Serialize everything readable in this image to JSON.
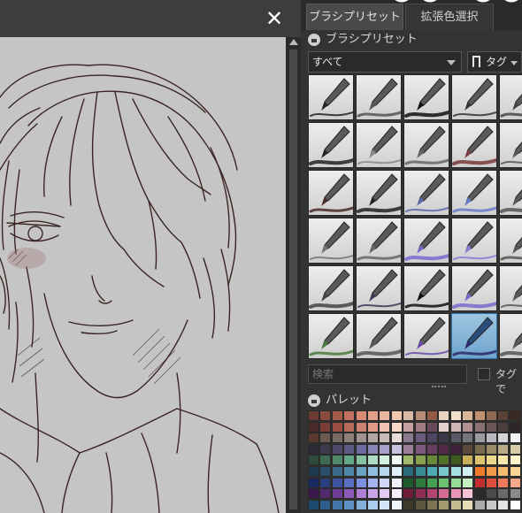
{
  "canvas": {
    "close_label": "✕"
  },
  "right_panel": {
    "tabs": [
      {
        "label": "ブラシプリセット"
      },
      {
        "label": "拡張色選択"
      }
    ],
    "brush_section": {
      "title": "ブラシプリセット"
    },
    "filter": {
      "selected": "すべて"
    },
    "tag_button": {
      "label": "タグ"
    },
    "search": {
      "placeholder": "検索",
      "checkbox_label": "タグで"
    },
    "palette_section": {
      "title": "パレット"
    },
    "brushes": [
      {
        "name": "mechanical-pen-brush"
      },
      {
        "name": "rough-pen-brush"
      },
      {
        "name": "g-pen-brush"
      },
      {
        "name": "airbrush-brush"
      },
      {
        "name": "cut-off-brush"
      },
      {
        "name": "marker-pen-brush"
      },
      {
        "name": "pencil-light-brush"
      },
      {
        "name": "pencil-brush"
      },
      {
        "name": "brush-pen-brush"
      },
      {
        "name": "cut-off-brush-2"
      },
      {
        "name": "watercolor-brush"
      },
      {
        "name": "ink-pen-brush"
      },
      {
        "name": "blue-pencil-brush"
      },
      {
        "name": "blue-pencil-brush-2"
      },
      {
        "name": "cut-off-brush-3"
      },
      {
        "name": "soft-pencil-brush"
      },
      {
        "name": "soft-pencil-brush-2"
      },
      {
        "name": "purple-pencil-brush"
      },
      {
        "name": "purple-pencil-brush-2"
      },
      {
        "name": "cut-off-brush-4"
      },
      {
        "name": "gray-marker-brush"
      },
      {
        "name": "blue-marker-brush"
      },
      {
        "name": "texture-marker-brush"
      },
      {
        "name": "text-pencil-brush"
      },
      {
        "name": "cut-off-brush-5"
      },
      {
        "name": "green-paint-brush"
      },
      {
        "name": "text-gray-brush"
      },
      {
        "name": "text-purple-brush"
      },
      {
        "name": "selected-pen-brush"
      },
      {
        "name": "cut-off-brush-6"
      }
    ],
    "palette_colors": [
      "#6b3a32",
      "#8a4a3e",
      "#a65a48",
      "#c47060",
      "#d98a72",
      "#e3a088",
      "#eab59e",
      "#f0c8b0",
      "#d8b8a6",
      "#b88a78",
      "#945a48",
      "#e8d4c0",
      "#f0e0cc",
      "#d9b89a",
      "#c09070",
      "#8e6a52",
      "#5a4236",
      "#3a2a22",
      "#4a2a2a",
      "#7a3e36",
      "#9a4e42",
      "#b86a5a",
      "#cc8272",
      "#e09a8a",
      "#f2c2b2",
      "#f8d8c8",
      "#c6a0a0",
      "#a07a80",
      "#6a4a5a",
      "#e6cfcf",
      "#cfb6b6",
      "#b09090",
      "#8a7070",
      "#6a5656",
      "#4a3e3e",
      "#2e2626",
      "#5a3a2e",
      "#6a5a52",
      "#7a6a64",
      "#8e8078",
      "#a09290",
      "#b4a6a2",
      "#c8bab6",
      "#e8dcd8",
      "#8a7a8e",
      "#6a5a7e",
      "#4e4466",
      "#3a3a4a",
      "#5a5a66",
      "#76767e",
      "#9a9aa0",
      "#b8b8be",
      "#d6d6da",
      "#f2f2f4",
      "#2e2a36",
      "#3e3a4e",
      "#4e4a6a",
      "#5e5a86",
      "#6e6aa2",
      "#8a86b8",
      "#a6a2cc",
      "#c6c2e0",
      "#9a7e9a",
      "#7e5a7e",
      "#6a3e5e",
      "#522a46",
      "#3e2038",
      "#5a4a3a",
      "#7a6a4e",
      "#9a8a66",
      "#b8aa84",
      "#d6cca6",
      "#2e4a3a",
      "#3e6a52",
      "#4e8a6a",
      "#62a886",
      "#86c2a2",
      "#aedcc2",
      "#d2efe0",
      "#eef8f2",
      "#a2b86a",
      "#86a04e",
      "#6a8a3a",
      "#52722a",
      "#3e5a1e",
      "#c8b05a",
      "#dcc470",
      "#ecd88a",
      "#f6e8aa",
      "#fff4cc",
      "#1e3a4e",
      "#2a4e6a",
      "#3a6a8a",
      "#4e86a6",
      "#6aa2c2",
      "#8ebede",
      "#b6d8ee",
      "#e0f0fa",
      "#2a6a7a",
      "#3a8a96",
      "#4eaab2",
      "#76c6cc",
      "#a6dee2",
      "#d2f0f2",
      "#ee7a2a",
      "#f29a4a",
      "#f6ba6e",
      "#fad696",
      "#1a2a5e",
      "#2a3e7e",
      "#3e52a2",
      "#5a6ec2",
      "#7e8ede",
      "#a6b2ee",
      "#cfd6f8",
      "#eef0fe",
      "#1e5a2e",
      "#2e7a3e",
      "#46a052",
      "#6ac270",
      "#96dc96",
      "#c6f0c2",
      "#c22e2e",
      "#de4e3e",
      "#ee7a5e",
      "#f6a68a",
      "#3a1a4e",
      "#522a6e",
      "#6e3e96",
      "#8e5ab8",
      "#ae7ed2",
      "#caa6e6",
      "#e2ccf4",
      "#f6eefc",
      "#6e1e3a",
      "#8e2e52",
      "#b2466e",
      "#d26a92",
      "#e896b6",
      "#f6c2d6",
      "#2a2a2a",
      "#4a4a4a",
      "#6a6a6a",
      "#8a8a8a",
      "#1e4a6e",
      "#2e5e8a",
      "#4276a6",
      "#5e92c2",
      "#82b0da",
      "#aacdee",
      "#d2e6f8",
      "#f0f8fe",
      "#3e3a2a",
      "#5e563e",
      "#7e7452",
      "#a29a6e",
      "#c6bc92",
      "#e6dcb6",
      "#aaaaaa",
      "#c8c8c8",
      "#e4e4e4",
      "#ffffff"
    ]
  }
}
